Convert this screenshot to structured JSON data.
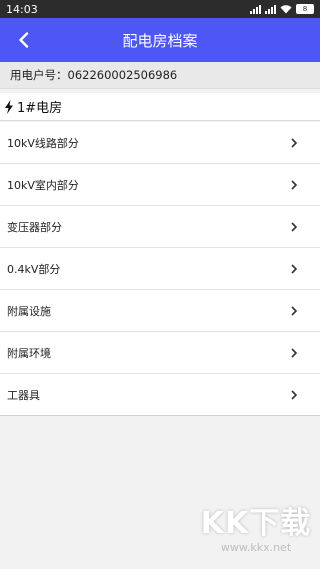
{
  "status": {
    "time": "14:03",
    "battery": "8"
  },
  "header": {
    "title": "配电房档案"
  },
  "user": {
    "account": "用电户号：062260002506986"
  },
  "room": {
    "name": "1#电房"
  },
  "items": [
    {
      "label": "10kV线路部分"
    },
    {
      "label": "10kV室内部分"
    },
    {
      "label": "变压器部分"
    },
    {
      "label": "0.4kV部分"
    },
    {
      "label": "附属设施"
    },
    {
      "label": "附属环境"
    },
    {
      "label": "工器具"
    }
  ],
  "watermark": {
    "logo": "KK下载",
    "url": "www.kkx.net"
  },
  "colors": {
    "accent": "#4d57f5",
    "statusbar": "#2c2c2c",
    "background": "#f2f2f2"
  }
}
